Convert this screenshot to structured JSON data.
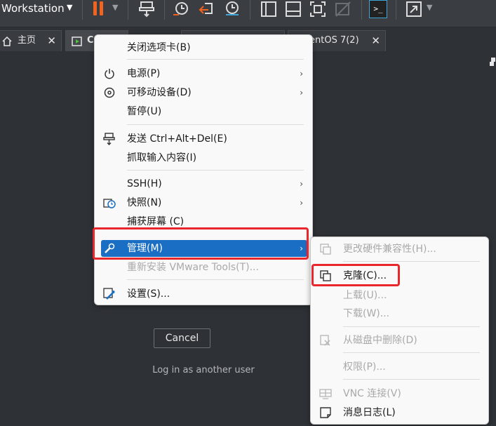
{
  "toolbar": {
    "app_title": "Workstation",
    "terminal_glyph": ">_",
    "icons": [
      "pause-icon",
      "send-keys-icon",
      "snapshot-icon",
      "revert-snapshot-icon",
      "snapshot-manager-icon",
      "sidebar-view-icon",
      "thumbnail-view-icon",
      "fit-guest-icon",
      "unity-disabled-icon",
      "console-view-icon",
      "fullscreen-icon"
    ],
    "pause_color": "#f2631f",
    "accent_color": "#3fa5d6"
  },
  "tabs": [
    {
      "label": "主页",
      "icon": "home-icon",
      "close": "✕"
    },
    {
      "label": "Ce",
      "icon": "vm-running-icon"
    },
    {
      "label": "entOS 7(2)",
      "close": "✕"
    }
  ],
  "console": {
    "cancel_label": "Cancel",
    "login_link": "Log in as another user"
  },
  "main_menu": {
    "items": [
      {
        "label": "关闭选项卡(B)"
      },
      {
        "label": "电源(P)",
        "icon": "power-icon",
        "has_submenu": true
      },
      {
        "label": "可移动设备(D)",
        "icon": "removable-device-icon",
        "has_submenu": true
      },
      {
        "label": "暂停(U)"
      },
      {
        "label": "发送 Ctrl+Alt+Del(E)",
        "icon": "send-keys-icon"
      },
      {
        "label": "抓取输入内容(I)"
      },
      {
        "label": "SSH(H)",
        "has_submenu": true
      },
      {
        "label": "快照(N)",
        "icon": "snapshot-icon",
        "has_submenu": true
      },
      {
        "label": "捕获屏幕 (C)"
      },
      {
        "label": "管理(M)",
        "icon": "wrench-icon",
        "has_submenu": true,
        "highlighted": true
      },
      {
        "label": "重新安装 VMware Tools(T)...",
        "disabled": true
      },
      {
        "label": "设置(S)...",
        "icon": "settings-icon"
      }
    ],
    "arrow": "›",
    "highlight_color": "#1a6ec4"
  },
  "manage_submenu": {
    "items": [
      {
        "label": "更改硬件兼容性(H)...",
        "icon": "hardware-compat-icon",
        "disabled": true
      },
      {
        "label": "克隆(C)...",
        "icon": "clone-icon"
      },
      {
        "label": "上载(U)...",
        "disabled": true
      },
      {
        "label": "下载(W)...",
        "disabled": true
      },
      {
        "label": "从磁盘中删除(D)",
        "icon": "delete-from-disk-icon",
        "disabled": true
      },
      {
        "label": "权限(P)...",
        "disabled": true
      },
      {
        "label": "VNC 连接(V)",
        "icon": "vnc-icon",
        "disabled": true
      },
      {
        "label": "消息日志(L)",
        "icon": "message-log-icon"
      }
    ]
  },
  "annotation_color": "#e8262b"
}
